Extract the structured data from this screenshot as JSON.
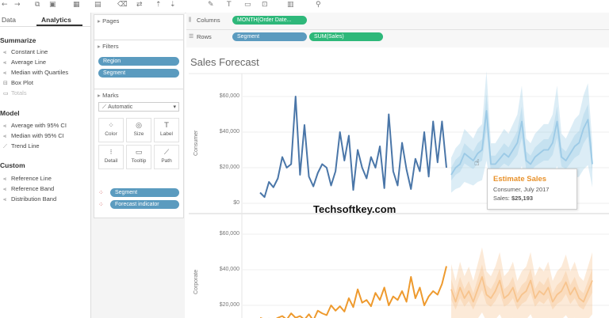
{
  "toolbar": {
    "icons": [
      "back-arrow-icon",
      "forward-arrow-icon",
      "new-datasource-icon",
      "save-icon",
      "new-sheet-icon",
      "duplicate-icon",
      "clear-icon",
      "swap-icon",
      "sort-asc-icon",
      "sort-desc-icon",
      "highlight-icon",
      "label-icon",
      "format-icon",
      "fit-icon",
      "show-me-icon",
      "pin-icon"
    ]
  },
  "left_pane": {
    "tabs": [
      "Data",
      "Analytics"
    ],
    "active_tab": "Analytics",
    "summarize": {
      "heading": "Summarize",
      "items": [
        "Constant Line",
        "Average Line",
        "Median with Quartiles",
        "Box Plot",
        "Totals"
      ]
    },
    "model": {
      "heading": "Model",
      "items": [
        "Average with 95% CI",
        "Median with 95% CI",
        "Trend Line"
      ]
    },
    "custom": {
      "heading": "Custom",
      "items": [
        "Reference Line",
        "Reference Band",
        "Distribution Band"
      ]
    }
  },
  "cards": {
    "pages": {
      "title": "Pages"
    },
    "filters": {
      "title": "Filters",
      "pills": [
        "Region",
        "Segment"
      ]
    },
    "marks": {
      "title": "Marks",
      "type_value": "Automatic",
      "buttons": [
        "Color",
        "Size",
        "Label",
        "Detail",
        "Tooltip",
        "Path"
      ],
      "fields": [
        "Segment",
        "Forecast indicator"
      ]
    }
  },
  "shelves": {
    "columns": {
      "label": "Columns",
      "pill": "MONTH(Order Date..."
    },
    "rows": {
      "label": "Rows",
      "pills": [
        "Segment",
        "SUM(Sales)"
      ]
    }
  },
  "view": {
    "title": "Sales Forecast",
    "panes": [
      {
        "label": "Consumer",
        "ticks": [
          "$60,000",
          "$40,000",
          "$20,000",
          "$0"
        ]
      },
      {
        "label": "Corporate",
        "ticks": [
          "$60,000",
          "$40,000",
          "$20,000"
        ]
      }
    ],
    "tooltip": {
      "title": "Estimate Sales",
      "line1": "Consumer, July 2017",
      "line2_label": "Sales: ",
      "line2_value": "$25,193"
    }
  },
  "watermark": "Techsoftkey.com",
  "colors": {
    "consumer": "#4a76a8",
    "consumer_forecast": "#9ccae6",
    "corporate": "#ee9a2e",
    "corporate_forecast": "#f7c48e",
    "pill_dimension": "#5b9bbf",
    "pill_measure": "#2eb87a"
  },
  "chart_data": [
    {
      "type": "line",
      "title": "Sales Forecast",
      "ylabel": "Consumer",
      "ylim": [
        0,
        65000
      ],
      "series": [
        {
          "values": [
            6000,
            3500,
            12000,
            9000,
            14000,
            26000,
            20000,
            22000,
            60000,
            16000,
            44000,
            15000,
            9500,
            17000,
            22000,
            20000,
            10000,
            18000,
            40000,
            24000,
            38000,
            7500,
            30000,
            20000,
            14000,
            26000,
            20000,
            32000,
            8500,
            50000,
            18000,
            10000,
            34000,
            19000,
            8000,
            25000,
            18000,
            40000,
            15000,
            46000,
            23000,
            46000,
            20000
          ]
        },
        {
          "values": [
            16000,
            20000,
            22000,
            28000,
            26000,
            24000,
            28000,
            30000,
            52000,
            22000,
            22000,
            25000,
            28000,
            26000,
            30000,
            34000,
            46000,
            24000,
            22000,
            26000,
            28000,
            30000,
            30000,
            34000,
            46000,
            26000,
            24000,
            28000,
            32000,
            34000,
            42000,
            47000,
            22000
          ]
        }
      ]
    },
    {
      "type": "line",
      "ylabel": "Corporate",
      "ylim": [
        10000,
        65000
      ],
      "series": [
        {
          "values": [
            13000,
            12000,
            12500,
            11500,
            13000,
            14000,
            12000,
            15500,
            13000,
            14000,
            12000,
            15000,
            11500,
            17000,
            15500,
            14500,
            20000,
            17000,
            19500,
            16500,
            24000,
            19000,
            29000,
            21500,
            23000,
            19500,
            27000,
            23000,
            30000,
            20000,
            25000,
            23000,
            28000,
            22000,
            36000,
            24000,
            30000,
            20000,
            25000,
            28000,
            26000,
            32000,
            42000
          ]
        },
        {
          "values": [
            29000,
            22000,
            30000,
            24000,
            28000,
            22000,
            29000,
            36000,
            26000,
            24000,
            28000,
            34000,
            24000,
            26000,
            30000,
            22000,
            26000,
            28000,
            34000,
            24000,
            28000,
            26000,
            30000,
            22000,
            26000,
            28000,
            33000,
            26000,
            30000,
            24000,
            22000,
            28000,
            34000
          ]
        }
      ]
    }
  ]
}
